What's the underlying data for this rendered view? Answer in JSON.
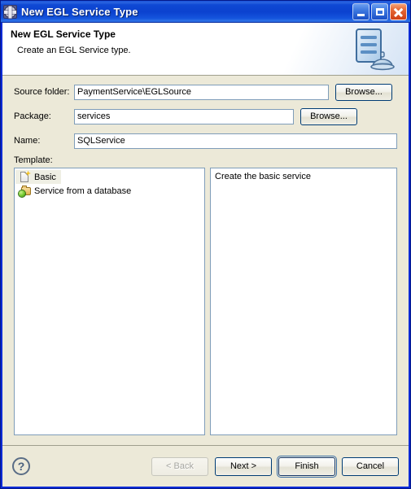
{
  "window": {
    "title": "New EGL Service Type",
    "title_icon": "gear-icon",
    "controls": {
      "minimize": "Minimize",
      "maximize": "Maximize",
      "close": "Close"
    }
  },
  "banner": {
    "title": "New EGL Service Type",
    "subtitle": "Create an EGL Service type.",
    "icon": "document-with-service-bell-icon"
  },
  "form": {
    "source_folder": {
      "label": "Source folder:",
      "value": "PaymentService\\EGLSource",
      "placeholder": "",
      "browse_label": "Browse..."
    },
    "package": {
      "label": "Package:",
      "value": "services",
      "placeholder": "",
      "browse_label": "Browse..."
    },
    "name": {
      "label": "Name:",
      "value": "SQLService",
      "placeholder": "",
      "focused": true
    }
  },
  "template": {
    "label": "Template:",
    "items": [
      {
        "label": "Basic",
        "icon": "new-document-icon",
        "selected": true
      },
      {
        "label": "Service from a database",
        "icon": "database-folder-icon",
        "selected": false
      }
    ],
    "description": "Create the basic service"
  },
  "buttons": {
    "help": "?",
    "back": "< Back",
    "next": "Next >",
    "finish": "Finish",
    "cancel": "Cancel"
  },
  "colors": {
    "title_bar_blue": "#0b41cf",
    "dialog_background": "#ece9d8",
    "field_border": "#7f9db9",
    "close_button_red": "#cf3f15",
    "selection_highlight": "#efefe4"
  }
}
